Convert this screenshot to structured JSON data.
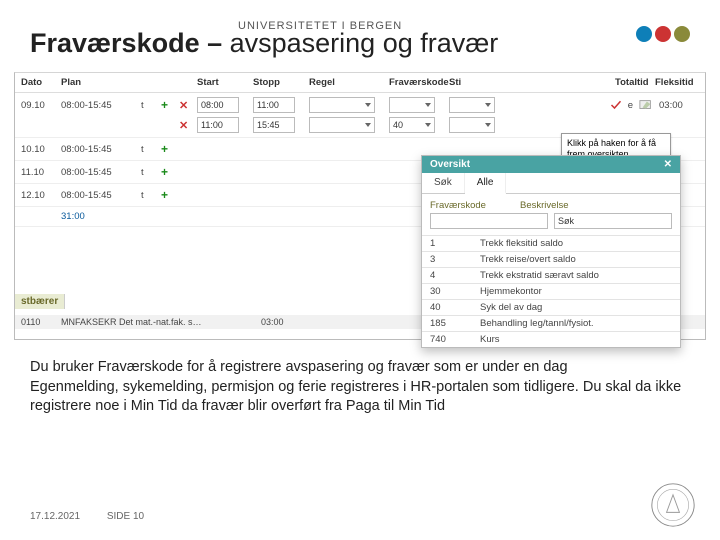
{
  "eyebrow": "UNIVERSITETET I BERGEN",
  "title_strong": "Fraværskode –",
  "title_rest": " avspasering og fravær",
  "headers": {
    "dato": "Dato",
    "plan": "Plan",
    "start": "Start",
    "stopp": "Stopp",
    "regel": "Regel",
    "fkode": "Fraværskode",
    "sti": "Sti",
    "totaltid": "Totaltid",
    "fleksitid": "Fleksitid"
  },
  "rows": [
    {
      "dato": "09.10",
      "plan": "08:00-15:45",
      "t": "t",
      "start": "08:00",
      "stopp": "11:00",
      "regel": "",
      "fkode": "",
      "sti": "",
      "e": "e",
      "tot": "03:00",
      "second": {
        "start": "11:00",
        "stopp": "15:45",
        "fkode": "40"
      }
    },
    {
      "dato": "10.10",
      "plan": "08:00-15:45",
      "t": "t"
    },
    {
      "dato": "11.10",
      "plan": "08:00-15:45",
      "t": "t"
    },
    {
      "dato": "12.10",
      "plan": "08:00-15:45",
      "t": "t"
    }
  ],
  "subtotal": "31:00",
  "cost_label": "stbærer",
  "cost_row": {
    "code": "0110",
    "text": "MNFAKSEKR Det mat.-nat.fak. s…",
    "val": "03:00"
  },
  "tip": "Klikk på haken for å få frem oversikten",
  "popup": {
    "title": "Oversikt",
    "tabs": [
      "Søk",
      "Alle"
    ],
    "col1": "Fraværskode",
    "col2": "Beskrivelse",
    "search": "Søk",
    "items": [
      {
        "code": "1",
        "desc": "Trekk fleksitid saldo"
      },
      {
        "code": "3",
        "desc": "Trekk reise/overt saldo"
      },
      {
        "code": "4",
        "desc": "Trekk ekstratid særavt saldo"
      },
      {
        "code": "30",
        "desc": "Hjemmekontor"
      },
      {
        "code": "40",
        "desc": "Syk del av dag"
      },
      {
        "code": "185",
        "desc": "Behandling leg/tannl/fysiot."
      },
      {
        "code": "740",
        "desc": "Kurs"
      }
    ]
  },
  "body": {
    "p1": "Du bruker Fraværskode for å registrere avspasering og fravær som er under en dag",
    "p2": "Egenmelding, sykemelding, permisjon og ferie registreres i HR-portalen som tidligere. Du skal da ikke registrere noe i Min Tid da fravær blir overført fra Paga til Min Tid"
  },
  "footer": {
    "date": "17.12.2021",
    "page": "SIDE 10"
  }
}
